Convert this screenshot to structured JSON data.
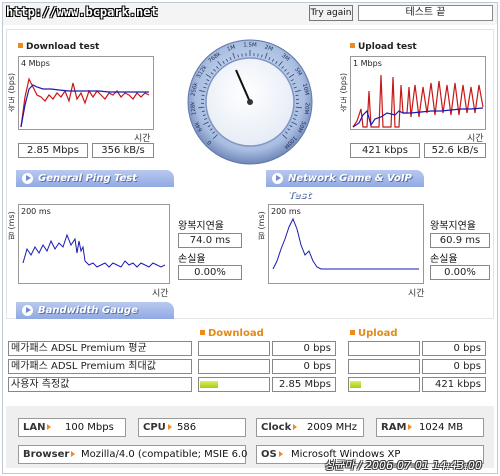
{
  "header": {
    "watermark_url": "http://www.bcpark.net",
    "try_again_label": "Try again",
    "status_text": "테스트 끝"
  },
  "download": {
    "title": "Download test",
    "ylabel": "속도 (bps)",
    "scale_label": "4 Mbps",
    "xlabel": "시간",
    "speed_mbps": "2.85 Mbps",
    "speed_kbs": "356 kB/s"
  },
  "upload": {
    "title": "Upload test",
    "ylabel": "속도 (bps)",
    "scale_label": "1 Mbps",
    "xlabel": "시간",
    "speed_kbps": "421 kbps",
    "speed_kbs": "52.6 kB/s"
  },
  "speedometer": {
    "scale_labels": [
      "0",
      "64k",
      "128k",
      "256k",
      "512k",
      "768k",
      "1M",
      "1.5M",
      "2M",
      "3M",
      "5M",
      "10M",
      "20M",
      "50M",
      "100M"
    ],
    "needle_value": "2.85 Mbps"
  },
  "ping_general": {
    "tab_label": "General Ping Test",
    "ylabel": "핑 (ms)",
    "scale_label": "200 ms",
    "xlabel": "시간",
    "latency_label": "왕복지연율",
    "latency_value": "74.0 ms",
    "loss_label": "손실율",
    "loss_value": "0.00%"
  },
  "ping_game": {
    "tab_label": "Network Game & VoIP Test",
    "ylabel": "핑 (ms)",
    "scale_label": "200 ms",
    "xlabel": "시간",
    "latency_label": "왕복지연율",
    "latency_value": "60.9 ms",
    "loss_label": "손실율",
    "loss_value": "0.00%"
  },
  "bandwidth": {
    "tab_label": "Bandwidth Gauge",
    "download_header": "Download",
    "upload_header": "Upload",
    "rows": [
      {
        "label": "메가패스 ADSL Premium 평균",
        "down": "0 bps",
        "up": "0 bps",
        "down_fill": 0,
        "up_fill": 0
      },
      {
        "label": "메가패스 ADSL Premium 최대값",
        "down": "0 bps",
        "up": "0 bps",
        "down_fill": 0,
        "up_fill": 0
      },
      {
        "label": "사용자 측정값",
        "down": "2.85 Mbps",
        "up": "421 kbps",
        "down_fill": 0.26,
        "up_fill": 0.16
      }
    ]
  },
  "sysinfo": {
    "lan_key": "LAN",
    "lan_val": "100 Mbps",
    "cpu_key": "CPU",
    "cpu_val": "586",
    "clock_key": "Clock",
    "clock_val": "2009 MHz",
    "ram_key": "RAM",
    "ram_val": "1024 MB",
    "browser_key": "Browser",
    "browser_val": "Mozilla/4.0 (compatible; MSIE 6.0",
    "os_key": "OS",
    "os_val": "Microsoft Windows XP"
  },
  "footer": {
    "watermark": "성균마 / 2006-07-01 14:43:00"
  },
  "colors": {
    "accent_orange": "#f08a1c",
    "tab_blue": "#91a9e3",
    "series_blue": "#1a1ab0",
    "series_red": "#c81818",
    "bar_green": "#a6cc1a"
  }
}
